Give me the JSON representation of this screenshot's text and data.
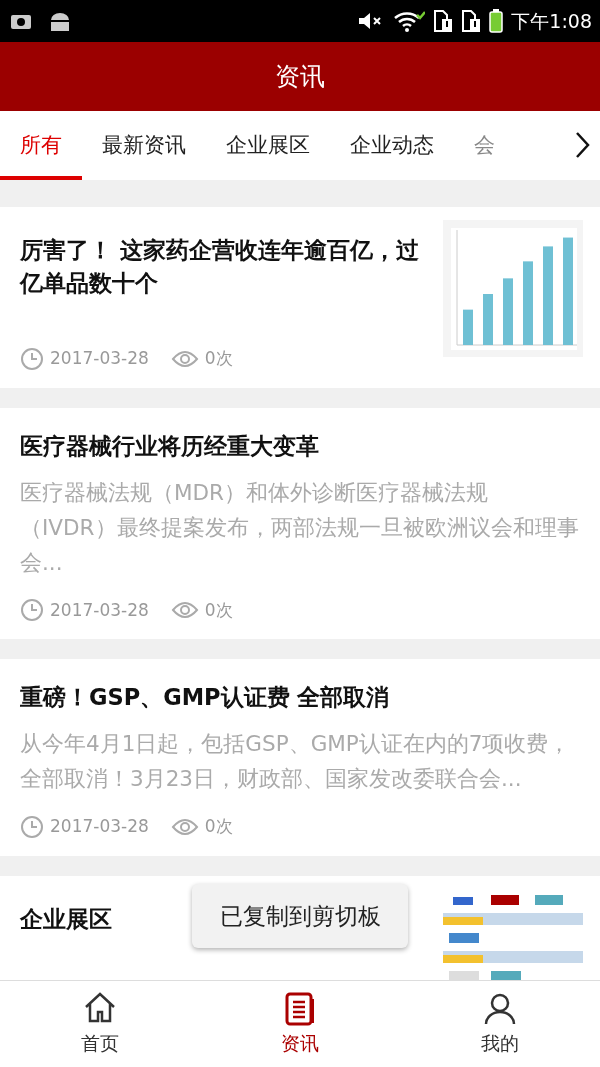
{
  "status_bar": {
    "time": "下午1:08"
  },
  "header": {
    "title": "资讯"
  },
  "tabs": [
    {
      "label": "所有",
      "selected": true
    },
    {
      "label": "最新资讯",
      "selected": false
    },
    {
      "label": "企业展区",
      "selected": false
    },
    {
      "label": "企业动态",
      "selected": false
    },
    {
      "label": "会",
      "selected": false
    }
  ],
  "articles": [
    {
      "kind": "thumb",
      "title": "厉害了！ 这家药企营收连年逾百亿，过亿单品数十个",
      "date": "2017-03-28",
      "views": "0次"
    },
    {
      "kind": "text",
      "title": "医疗器械行业将历经重大变革",
      "summary": "医疗器械法规（MDR）和体外诊断医疗器械法规（IVDR）最终提案发布，两部法规一旦被欧洲议会和理事会...",
      "date": "2017-03-28",
      "views": "0次"
    },
    {
      "kind": "text",
      "title": "重磅！GSP、GMP认证费 全部取消",
      "summary": "从今年4月1日起，包括GSP、GMP认证在内的7项收费，全部取消！3月23日，财政部、国家发改委联合会...",
      "date": "2017-03-28",
      "views": "0次"
    },
    {
      "kind": "thumb",
      "title": "企业展区"
    }
  ],
  "toast": {
    "text": "已复制到剪切板"
  },
  "bottom_nav": [
    {
      "label": "首页",
      "selected": false
    },
    {
      "label": "资讯",
      "selected": true
    },
    {
      "label": "我的",
      "selected": false
    }
  ]
}
